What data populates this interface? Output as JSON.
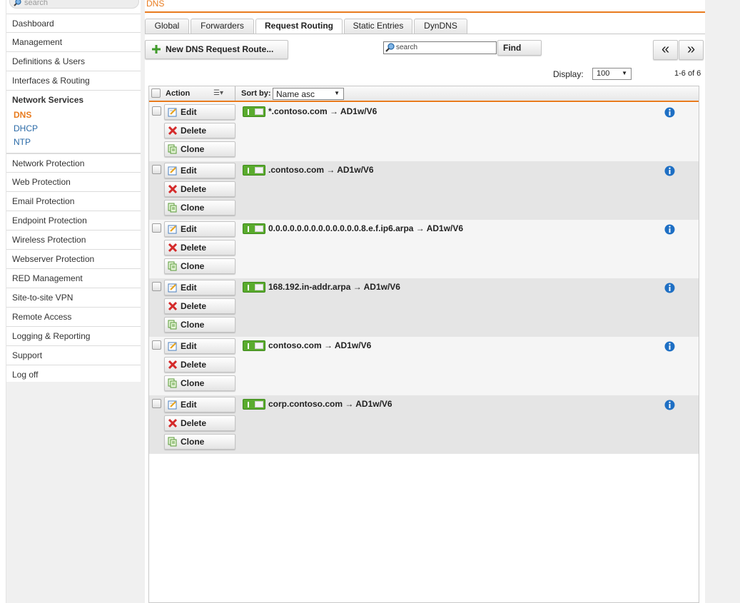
{
  "sidebar": {
    "search_placeholder": "search",
    "items_top": [
      "Dashboard",
      "Management",
      "Definitions & Users",
      "Interfaces & Routing"
    ],
    "group": {
      "label": "Network Services",
      "subitems": [
        "DNS",
        "DHCP",
        "NTP"
      ],
      "active": "DNS"
    },
    "items_bottom": [
      "Network Protection",
      "Web Protection",
      "Email Protection",
      "Endpoint Protection",
      "Wireless Protection",
      "Webserver Protection",
      "RED Management",
      "Site-to-site VPN",
      "Remote Access",
      "Logging & Reporting",
      "Support",
      "Log off"
    ]
  },
  "header": {
    "breadcrumb": "DNS",
    "accent_color": "#e87b1e"
  },
  "tabs": [
    {
      "label": "Global"
    },
    {
      "label": "Forwarders"
    },
    {
      "label": "Request Routing",
      "active": true
    },
    {
      "label": "Static Entries"
    },
    {
      "label": "DynDNS"
    }
  ],
  "toolbar": {
    "new_button": "New DNS Request Route...",
    "search_placeholder": "search",
    "find_button": "Find",
    "prev_button": "«",
    "next_button": "»",
    "display_label": "Display:",
    "display_value": "100",
    "count": "1-6 of 6"
  },
  "list": {
    "header": {
      "action": "Action",
      "sort_label": "Sort by:",
      "sort_value": "Name asc"
    },
    "action_labels": {
      "edit": "Edit",
      "delete": "Delete",
      "clone": "Clone"
    },
    "rows": [
      {
        "label": "*.contoso.com → AD1w/V6",
        "enabled": true
      },
      {
        "label": ".contoso.com → AD1w/V6",
        "enabled": true
      },
      {
        "label": "0.0.0.0.0.0.0.0.0.0.0.0.0.8.e.f.ip6.arpa → AD1w/V6",
        "enabled": true
      },
      {
        "label": "168.192.in-addr.arpa → AD1w/V6",
        "enabled": true
      },
      {
        "label": "contoso.com → AD1w/V6",
        "enabled": true
      },
      {
        "label": "corp.contoso.com → AD1w/V6",
        "enabled": true
      }
    ]
  }
}
